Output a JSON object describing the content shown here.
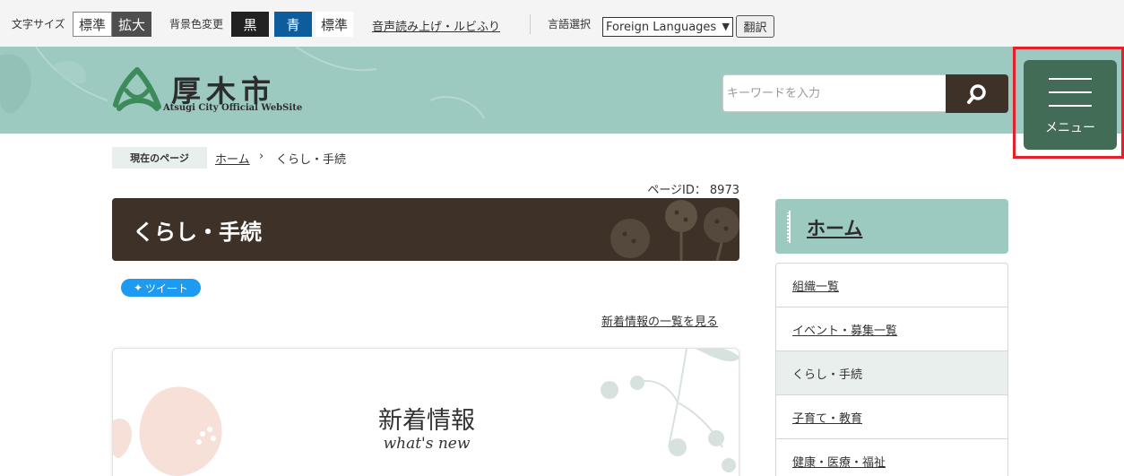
{
  "utility_bar": {
    "font_size_label": "文字サイズ",
    "font_standard": "標準",
    "font_large": "拡大",
    "bg_color_label": "背景色変更",
    "bg_black": "黒",
    "bg_blue": "青",
    "bg_standard": "標準",
    "reading_link": "音声読み上げ・ルビふり",
    "language_label": "言語選択",
    "language_selected": "Foreign Languages",
    "translate_button": "翻訳"
  },
  "header": {
    "logo_text": "厚木市",
    "logo_subtext": "Atsugi City Official WebSite",
    "search_placeholder": "キーワードを入力",
    "menu_label": "メニュー"
  },
  "breadcrumb": {
    "current_label": "現在のページ",
    "home": "ホーム",
    "separator": "›",
    "current_page": "くらし・手続"
  },
  "page": {
    "id_label": "ページID：",
    "id_value": "8973",
    "title": "くらし・手続",
    "tweet_label": "ツイート",
    "news_list_link": "新着情報の一覧を見る",
    "news_title": "新着情報",
    "news_subtitle": "what's new"
  },
  "sidebar": {
    "heading": "ホーム",
    "items": [
      {
        "label": "組織一覧"
      },
      {
        "label": "イベント・募集一覧"
      },
      {
        "label": "くらし・手続"
      },
      {
        "label": "子育て・教育"
      },
      {
        "label": "健康・医療・福祉"
      }
    ]
  },
  "colors": {
    "accent_teal": "#9ccac0",
    "dark_brown": "#3e3228",
    "menu_green": "#436c57",
    "highlight_red": "#e5202b",
    "twitter_blue": "#1d9bf0"
  }
}
